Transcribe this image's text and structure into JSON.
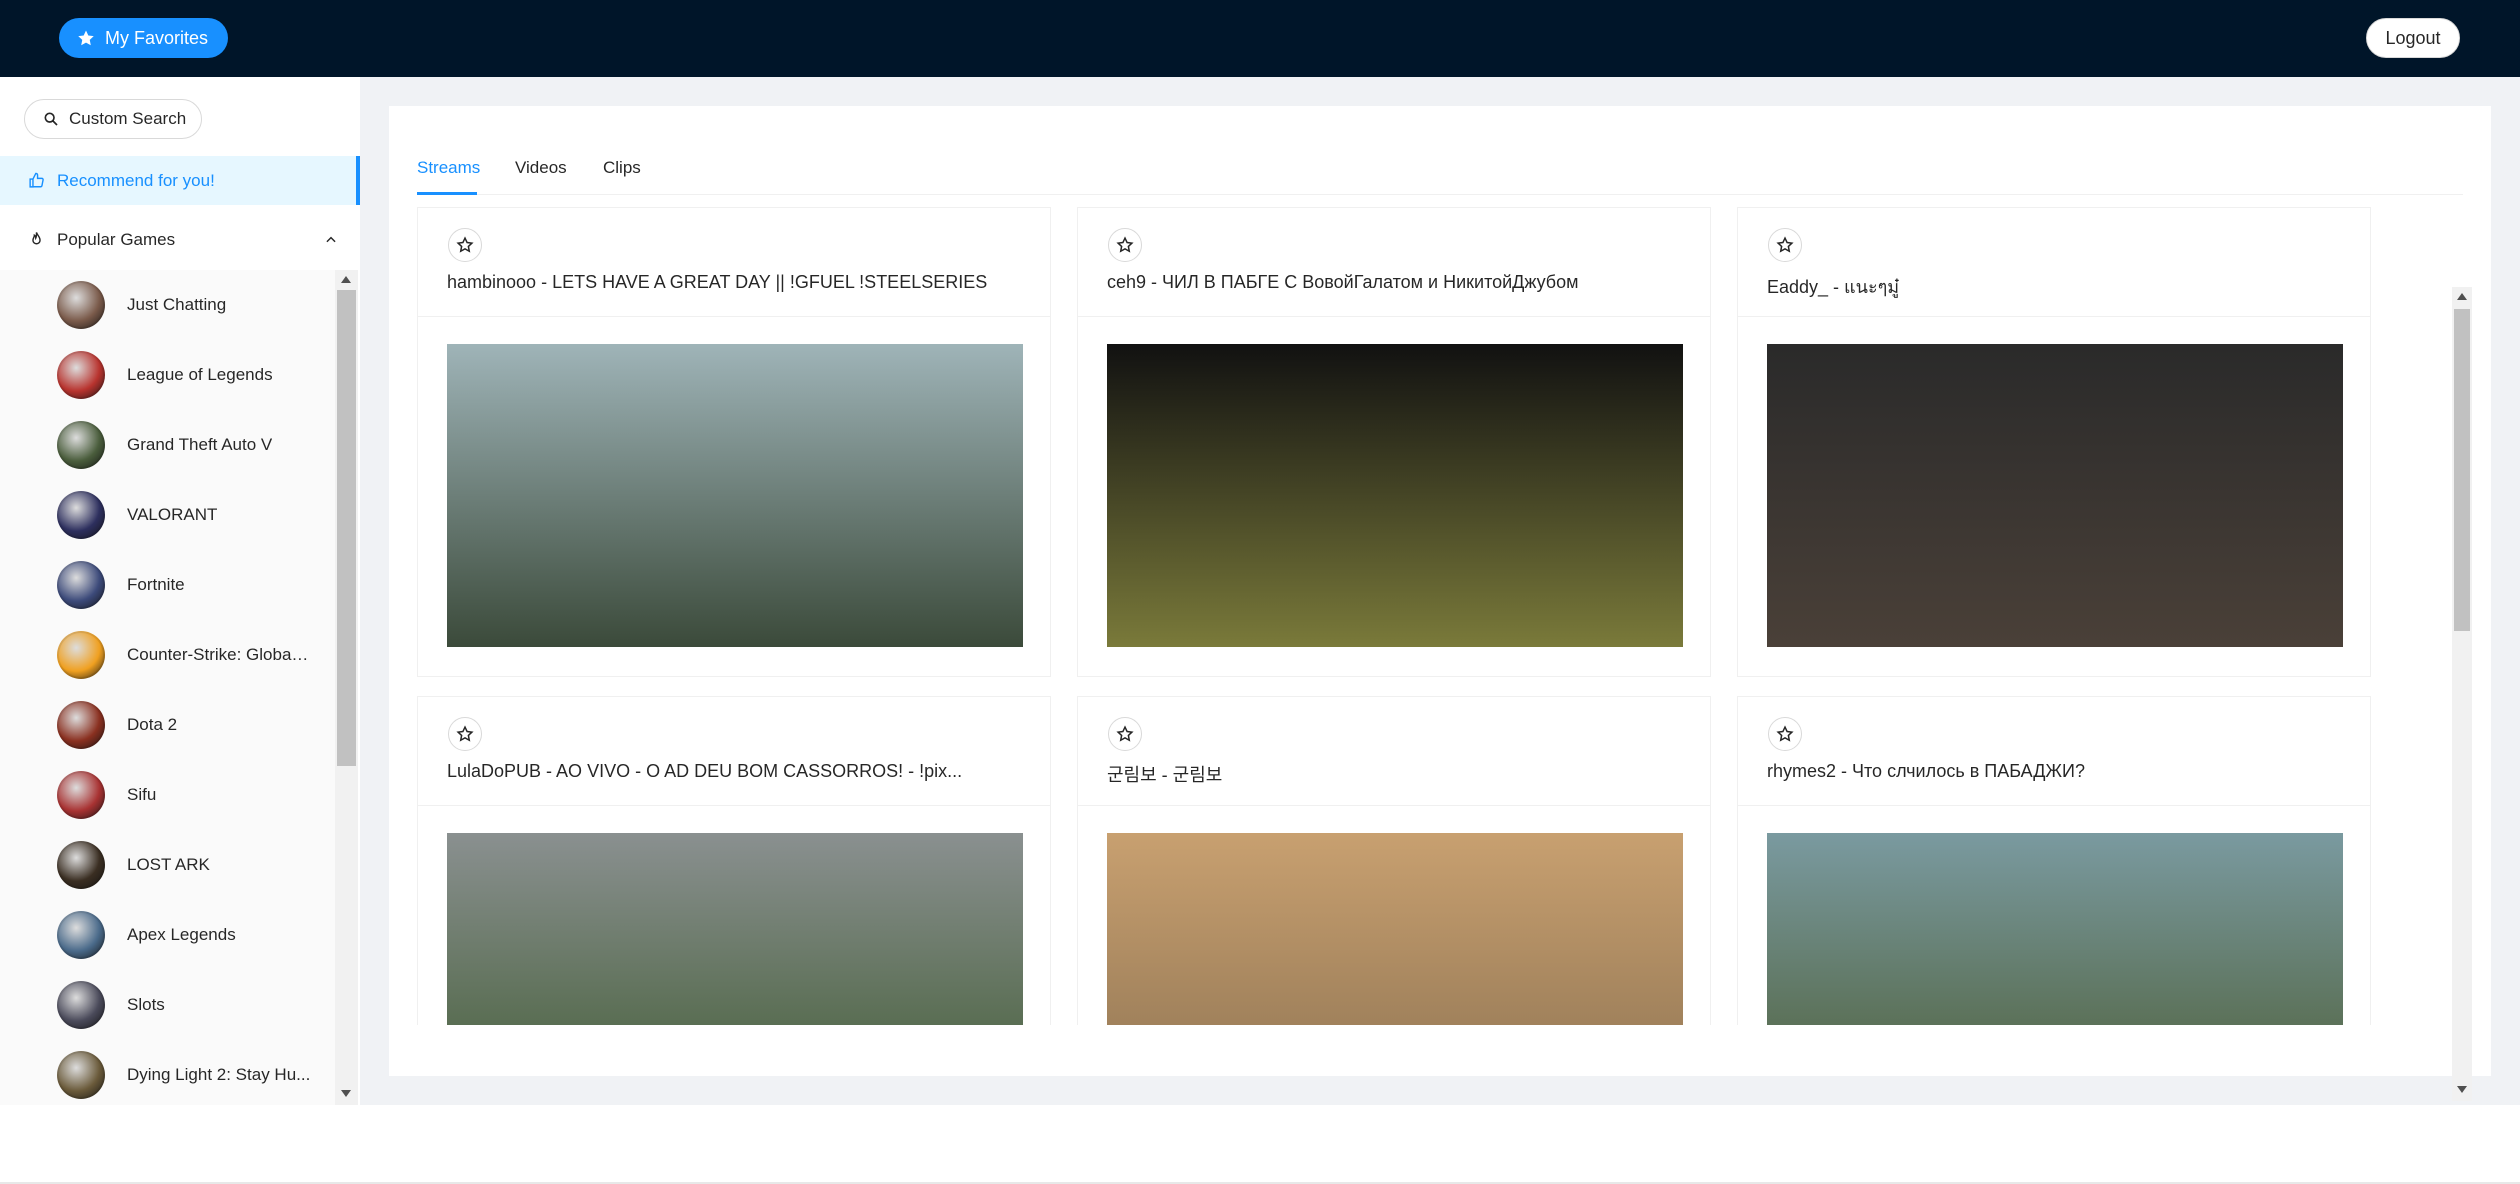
{
  "header": {
    "favorites_label": "My Favorites",
    "logout_label": "Logout"
  },
  "sidebar": {
    "search_label": "Custom Search",
    "recommend_label": "Recommend for you!",
    "popular_label": "Popular Games",
    "games": [
      {
        "name": "Just Chatting",
        "color": "#7a5a4a"
      },
      {
        "name": "League of Legends",
        "color": "#b8332e"
      },
      {
        "name": "Grand Theft Auto V",
        "color": "#4a5d3c"
      },
      {
        "name": "VALORANT",
        "color": "#2d2f5e"
      },
      {
        "name": "Fortnite",
        "color": "#3c4a7a"
      },
      {
        "name": "Counter-Strike: Global ...",
        "color": "#f0a020"
      },
      {
        "name": "Dota 2",
        "color": "#8a3020"
      },
      {
        "name": "Sifu",
        "color": "#a83232"
      },
      {
        "name": "LOST ARK",
        "color": "#3a2e22"
      },
      {
        "name": "Apex Legends",
        "color": "#4a6a8a"
      },
      {
        "name": "Slots",
        "color": "#4a4a5a"
      },
      {
        "name": "Dying Light 2: Stay Hu...",
        "color": "#6a5a3a"
      }
    ]
  },
  "tabs": [
    "Streams",
    "Videos",
    "Clips"
  ],
  "streams": [
    {
      "title": "hambinooo - LETS HAVE A GREAT DAY || !GFUEL !STEELSERIES",
      "thumb_top": "#9fb4b8",
      "thumb_bottom": "#3b4a3a"
    },
    {
      "title": "ceh9 - ЧИЛ В ПАБГЕ С ВовойГалатом и НикитойДжубом",
      "thumb_top": "#111111",
      "thumb_bottom": "#7a7a3a"
    },
    {
      "title": "Eaddy_ - แนะๆมู๋",
      "thumb_top": "#2a2a2a",
      "thumb_bottom": "#4a4038"
    },
    {
      "title": "LulaDoPUB - AO VIVO - O AD DEU BOM CASSORROS! - !pix...",
      "thumb_top": "#8a9090",
      "thumb_bottom": "#3e5a30"
    },
    {
      "title": "군림보 - 군림보",
      "thumb_top": "#c8a070",
      "thumb_bottom": "#8a7050"
    },
    {
      "title": "rhymes2 - Что слчилось в ПАБАДЖИ?",
      "thumb_top": "#7a9aa0",
      "thumb_bottom": "#4a5a30"
    }
  ],
  "colors": {
    "accent": "#1890ff",
    "header_bg": "#001529"
  }
}
